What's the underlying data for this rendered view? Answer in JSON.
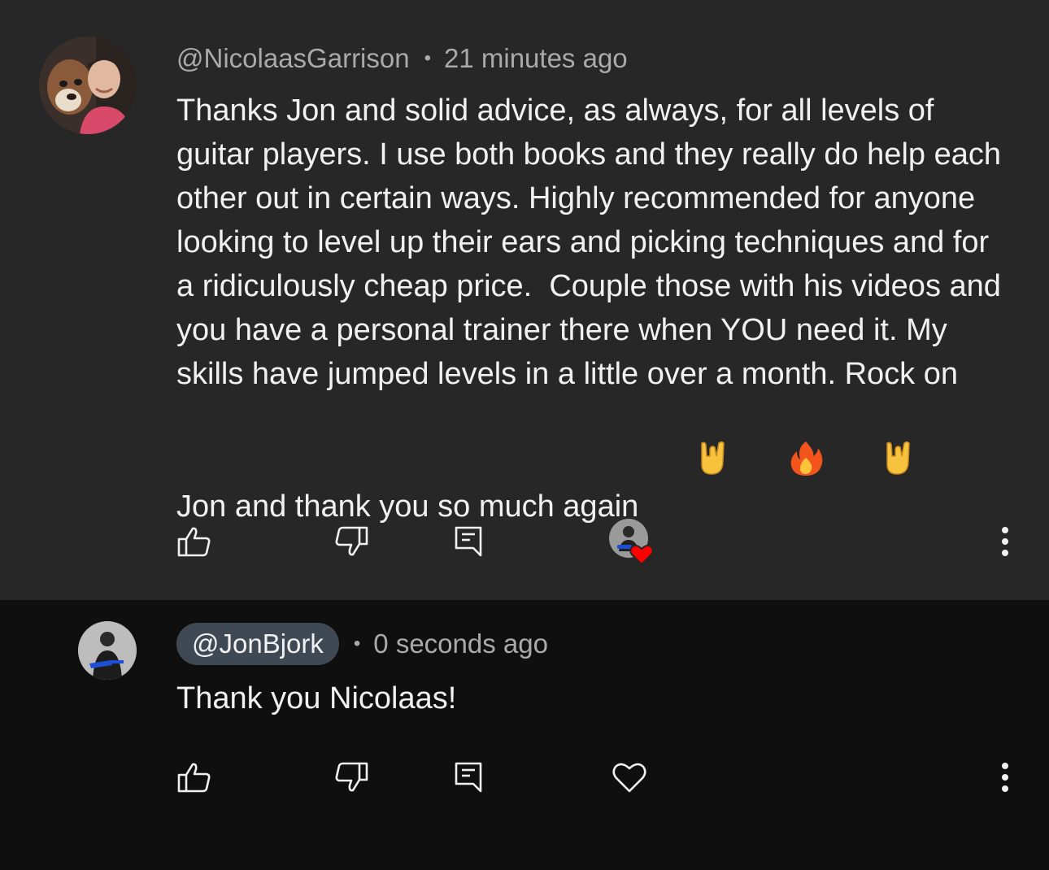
{
  "top_comment": {
    "author": "@NicolaasGarrison",
    "separator": "•",
    "time": "21 minutes ago",
    "text": "Thanks Jon and solid advice, as always, for all levels of guitar players. I use both books and they really do help each other out in certain ways. Highly recommended for anyone looking to level up their ears and picking techniques and for a ridiculously cheap price.  Couple those with his videos and you have a personal trainer there when YOU need it. My skills have jumped levels in a little over a month. Rock on Jon and thank you so much again",
    "emojis": [
      "🤘",
      "🔥",
      "🤘"
    ],
    "hearted_by_creator": true
  },
  "reply_comment": {
    "author": "@JonBjork",
    "separator": "•",
    "time": "0 seconds ago",
    "text": "Thank you Nicolaas!",
    "hearted": false
  },
  "colors": {
    "top_background": "#272727",
    "reply_background": "#0f0f0f",
    "text_primary": "#f1f1f1",
    "text_secondary": "#aaaaaa",
    "author_chip": "#3e4954",
    "heart_red": "#ff0000"
  },
  "icons": [
    "thumbs-up-icon",
    "thumbs-down-icon",
    "reply-icon",
    "heart-icon",
    "more-vertical-icon"
  ]
}
